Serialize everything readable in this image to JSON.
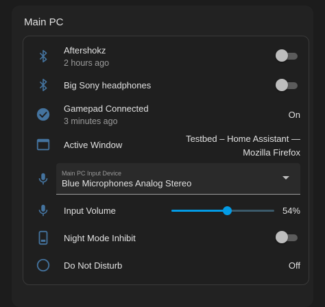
{
  "section": {
    "title": "Main PC"
  },
  "colors": {
    "accent": "#039be5",
    "icon": "#44739e"
  },
  "entities": {
    "aftershokz": {
      "name": "Aftershokz",
      "secondary": "2 hours ago",
      "toggle_on": false,
      "icon": "bluetooth-icon"
    },
    "sony": {
      "name": "Big Sony headphones",
      "toggle_on": false,
      "icon": "bluetooth-icon"
    },
    "gamepad": {
      "name": "Gamepad Connected",
      "secondary": "3 minutes ago",
      "state": "On",
      "icon": "check-circle-icon"
    },
    "active_window": {
      "name": "Active Window",
      "state": "Testbed – Home Assistant — Mozilla Firefox",
      "icon": "window-icon"
    },
    "input_device": {
      "label": "Main PC Input Device",
      "value": "Blue Microphones Analog Stereo",
      "icon": "microphone-icon"
    },
    "input_volume": {
      "name": "Input Volume",
      "value_percent": 54,
      "state": "54%",
      "icon": "microphone-icon"
    },
    "night_mode": {
      "name": "Night Mode Inhibit",
      "toggle_on": false,
      "icon": "phone-icon"
    },
    "dnd": {
      "name": "Do Not Disturb",
      "state": "Off",
      "icon": "circle-outline-icon"
    }
  }
}
